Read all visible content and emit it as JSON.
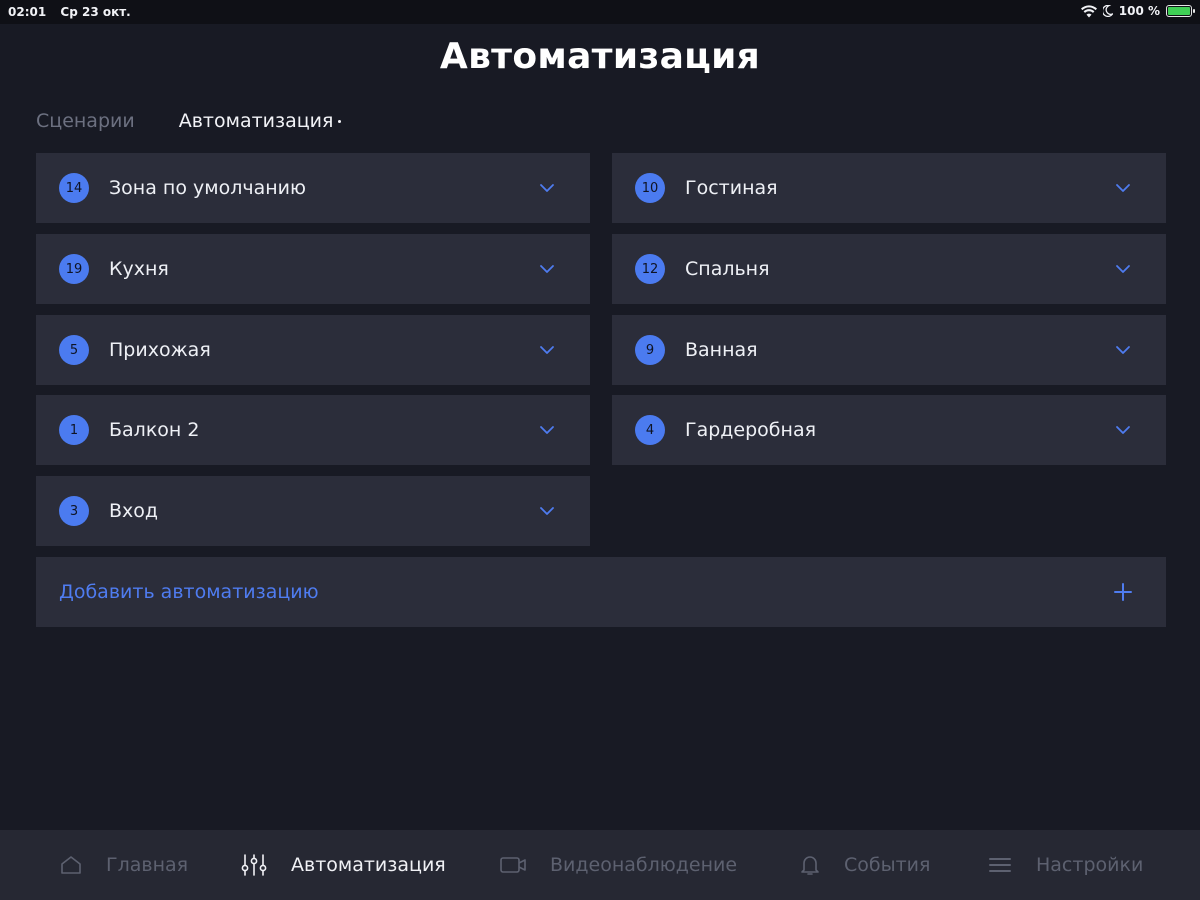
{
  "status_bar": {
    "time": "02:01",
    "date": "Ср 23 окт.",
    "battery": "100 %",
    "battery_level": 1.0
  },
  "page_title": "Автоматизация",
  "tabs": [
    {
      "label": "Сценарии",
      "active": false
    },
    {
      "label": "Автоматизация",
      "active": true
    }
  ],
  "zones": [
    {
      "count": "14",
      "label": "Зона по умолчанию"
    },
    {
      "count": "10",
      "label": "Гостиная"
    },
    {
      "count": "19",
      "label": "Кухня"
    },
    {
      "count": "12",
      "label": "Спальня"
    },
    {
      "count": "5",
      "label": "Прихожая"
    },
    {
      "count": "9",
      "label": "Ванная"
    },
    {
      "count": "1",
      "label": "Балкон 2"
    },
    {
      "count": "4",
      "label": "Гардеробная"
    },
    {
      "count": "3",
      "label": "Вход"
    }
  ],
  "add_automation": {
    "label": "Добавить автоматизацию"
  },
  "bottom_nav": [
    {
      "label": "Главная",
      "icon": "home-icon",
      "active": false
    },
    {
      "label": "Автоматизация",
      "icon": "sliders-icon",
      "active": true
    },
    {
      "label": "Видеонаблюдение",
      "icon": "camera-icon",
      "active": false
    },
    {
      "label": "События",
      "icon": "bell-icon",
      "active": false
    },
    {
      "label": "Настройки",
      "icon": "menu-icon",
      "active": false
    }
  ],
  "colors": {
    "background": "#181a24",
    "card": "#2b2d3a",
    "accent": "#4b7bf0",
    "nav_bar": "#262833"
  }
}
